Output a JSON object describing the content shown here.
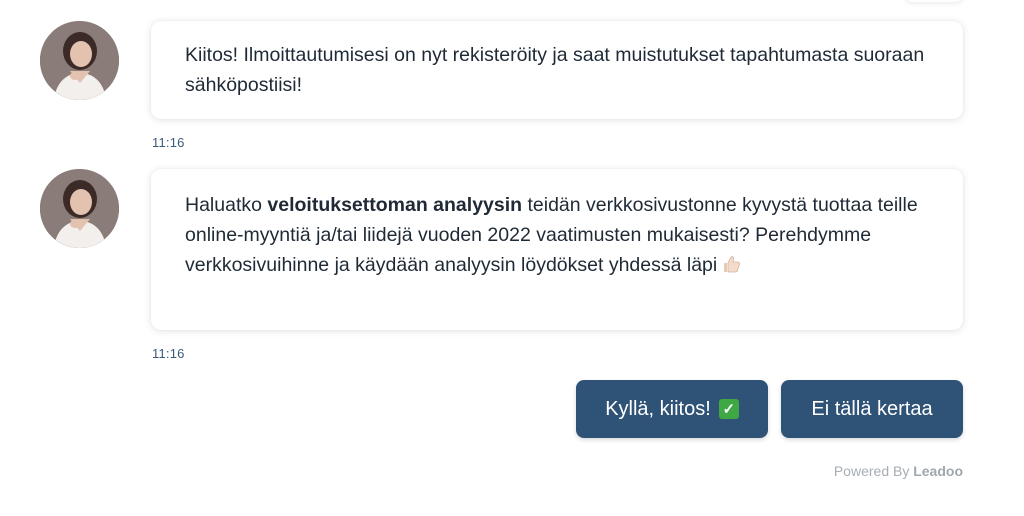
{
  "messages": [
    {
      "text": "Kiitos! Ilmoittautumisesi on nyt rekisteröity ja saat muistutukset tapahtumasta suoraan sähköpostiisi!",
      "time": "11:16"
    },
    {
      "text_before": "Haluatko ",
      "text_bold": "veloituksettoman analyysin",
      "text_after": " teidän verkkosivustonne kyvystä tuottaa teille online-myyntiä ja/tai liidejä vuoden 2022 vaatimusten mukaisesti? Perehdymme verkkosivuihinne ja käydään analyysin löydökset yhdessä läpi",
      "emoji": "thumbs-up-icon",
      "time": "11:16"
    }
  ],
  "replies": [
    {
      "label": "Kyllä, kiitos!",
      "emoji": "check-mark-icon"
    },
    {
      "label": "Ei tällä kertaa"
    }
  ],
  "footer": {
    "powered_by": "Powered By",
    "brand": "Leadoo"
  },
  "colors": {
    "button_bg": "#2f5277",
    "timestamp": "#3c5a79",
    "check_emoji": "#3fa845"
  }
}
